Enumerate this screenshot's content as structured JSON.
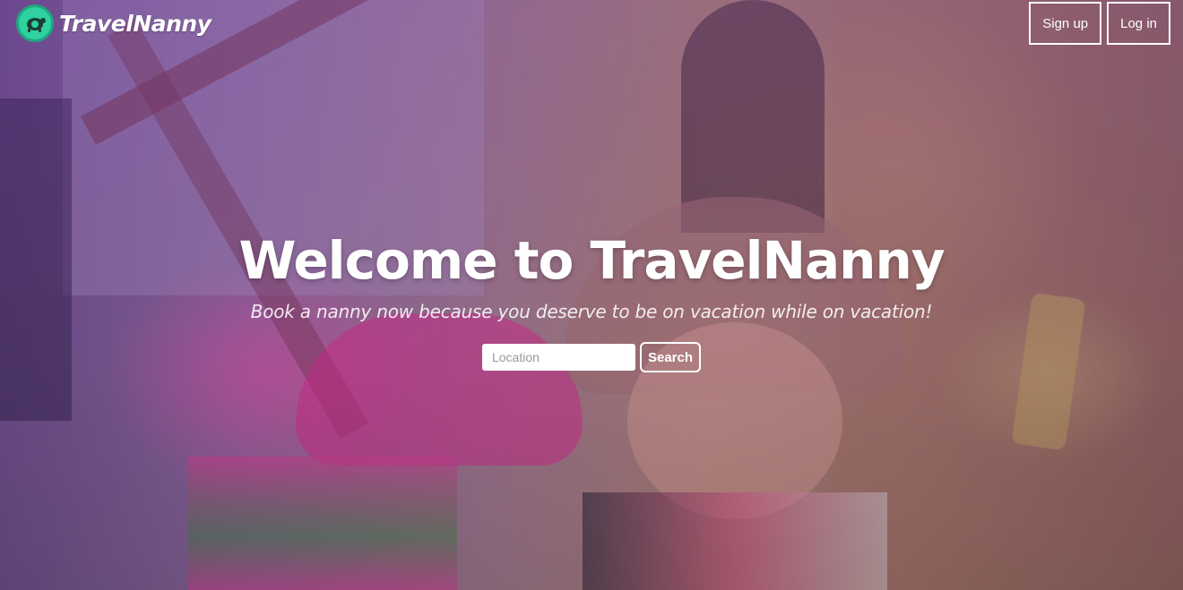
{
  "brand": {
    "name": "TravelNanny",
    "logo_icon": "turtle-logo-icon",
    "logo_color": "#2fd1a0"
  },
  "nav": {
    "signup_label": "Sign up",
    "login_label": "Log in"
  },
  "hero": {
    "title": "Welcome to TravelNanny",
    "subtitle": "Book a nanny now because you deserve to be on vacation while on vacation!",
    "overlay_color": "#6e3c96"
  },
  "search": {
    "placeholder": "Location",
    "value": "",
    "button_label": "Search"
  }
}
